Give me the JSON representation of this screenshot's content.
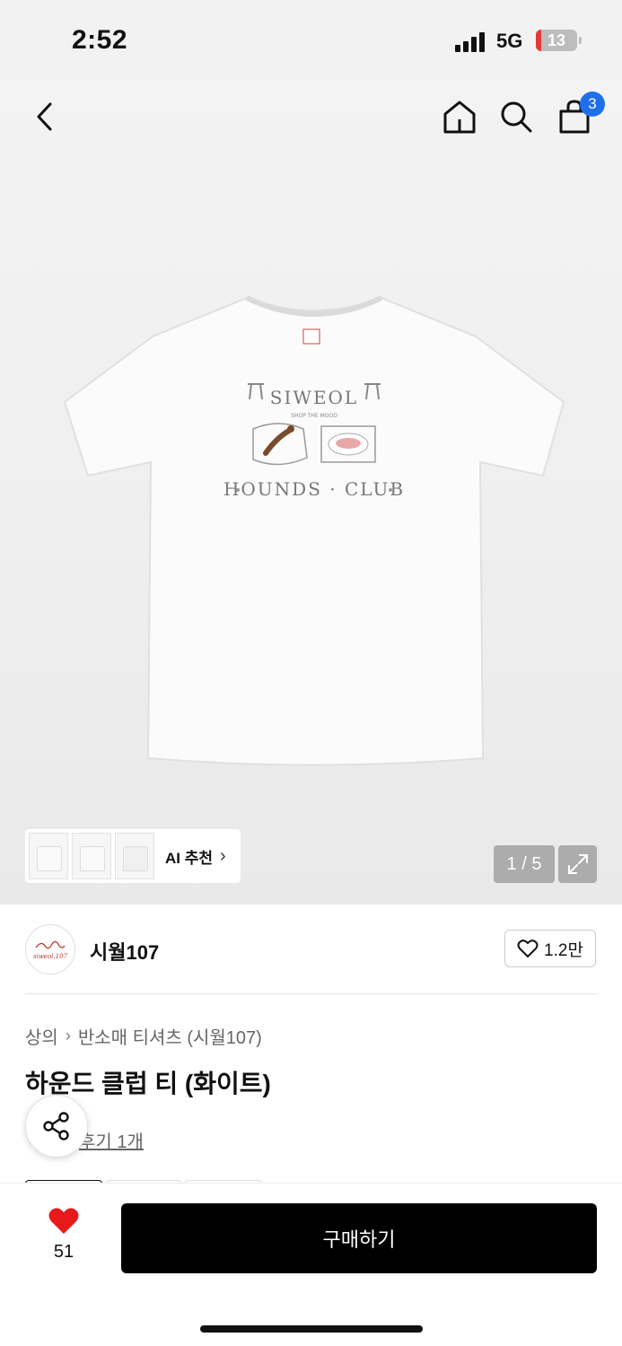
{
  "status_bar": {
    "time": "2:52",
    "network": "5G",
    "battery": "13"
  },
  "header": {
    "back_icon": "chevron-left-icon",
    "home_icon": "home-icon",
    "search_icon": "search-icon",
    "cart_icon": "shopping-bag-icon",
    "cart_count": "3",
    "badge_color": "#1f6feb"
  },
  "gallery": {
    "product_image": "white t-shirt with SIWEOL HOUNDS CLUB print",
    "ai_label": "AI 추천",
    "page_counter": "1 / 5",
    "expand_icon": "expand-icon"
  },
  "brand": {
    "logo_text": "siweol.107",
    "name": "시월107",
    "like_count": "1.2만"
  },
  "product": {
    "breadcrumb": [
      "상의",
      "반소매 티셔츠 (시월107)"
    ],
    "title": "하운드 클럽 티 (화이트)",
    "review_text": "후기 1개",
    "share_icon": "share-icon"
  },
  "bottom_bar": {
    "wish_count": "51",
    "wish_color": "#e8191b",
    "buy_label": "구매하기"
  }
}
